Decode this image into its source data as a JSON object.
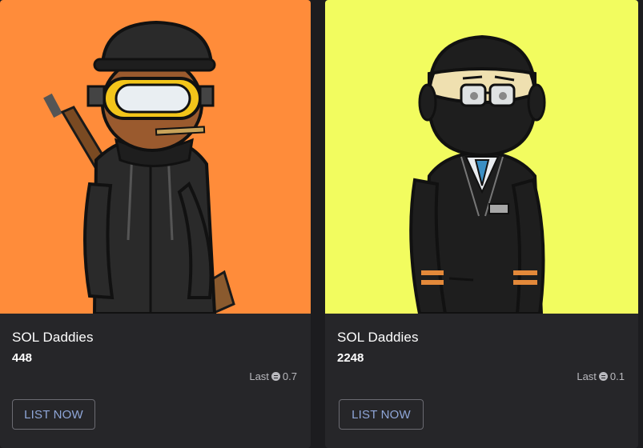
{
  "cards": [
    {
      "collection": "SOL Daddies",
      "token_id": "448",
      "last_label": "Last",
      "last_price": "0.7",
      "currency_icon": "solana-icon",
      "button_label": "LIST NOW",
      "background_color": "#ff8c3a"
    },
    {
      "collection": "SOL Daddies",
      "token_id": "2248",
      "last_label": "Last",
      "last_price": "0.1",
      "currency_icon": "solana-icon",
      "button_label": "LIST NOW",
      "background_color": "#f2fc5f"
    }
  ],
  "colors": {
    "page_bg": "#1c1c1f",
    "card_bg": "#262629",
    "button_text": "#8fa6d8",
    "muted_text": "#b9b9be"
  }
}
